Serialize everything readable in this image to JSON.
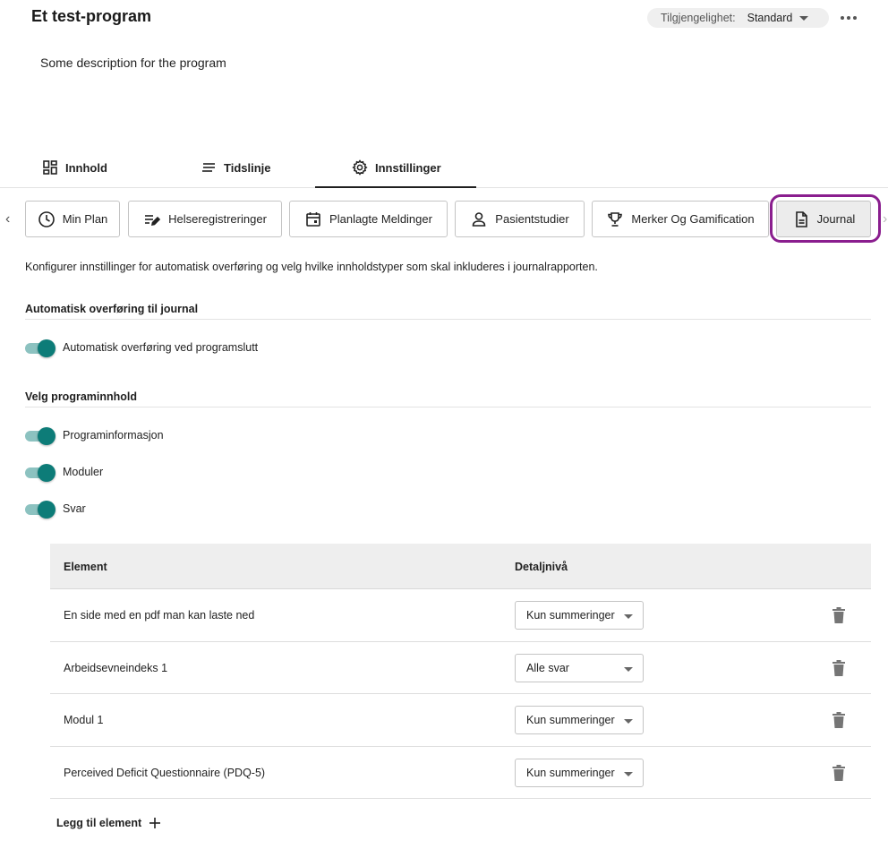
{
  "header": {
    "title": "Et test-program",
    "availability_label": "Tilgjengelighet:",
    "availability_value": "Standard",
    "more_icon": "more-horizontal-icon"
  },
  "description": "Some description for the program",
  "main_tabs": [
    {
      "label": "Innhold",
      "icon": "grid-icon"
    },
    {
      "label": "Tidslinje",
      "icon": "lines-icon"
    },
    {
      "label": "Innstillinger",
      "icon": "gear-icon",
      "active": true
    }
  ],
  "settings_tabs": [
    {
      "label": "Min Plan",
      "icon": "clock-icon"
    },
    {
      "label": "Helseregistreringer",
      "icon": "edit-list-icon"
    },
    {
      "label": "Planlagte Meldinger",
      "icon": "calendar-icon"
    },
    {
      "label": "Pasientstudier",
      "icon": "person-icon"
    },
    {
      "label": "Merker Og Gamification",
      "icon": "trophy-icon"
    },
    {
      "label": "Journal",
      "icon": "document-icon",
      "selected": true
    }
  ],
  "intro": "Konfigurer innstillinger for automatisk overføring og velg hvilke innholdstyper som skal inkluderes i journalrapporten.",
  "auto_transfer": {
    "heading": "Automatisk overføring til journal",
    "toggle_label": "Automatisk overføring ved programslutt",
    "enabled": true
  },
  "content_selection": {
    "heading": "Velg programinnhold",
    "toggles": [
      {
        "label": "Programinformasjon",
        "enabled": true
      },
      {
        "label": "Moduler",
        "enabled": true
      },
      {
        "label": "Svar",
        "enabled": true
      }
    ]
  },
  "table": {
    "headers": {
      "element": "Element",
      "detail": "Detaljnivå"
    },
    "rows": [
      {
        "element": "En side med en pdf man kan laste ned",
        "detail": "Kun summeringer"
      },
      {
        "element": "Arbeidsevneindeks 1",
        "detail": "Alle svar"
      },
      {
        "element": "Modul 1",
        "detail": "Kun summeringer"
      },
      {
        "element": "Perceived Deficit Questionnaire (PDQ-5)",
        "detail": "Kun summeringer"
      }
    ]
  },
  "add_element_label": "Legg til element",
  "colors": {
    "toggle_on": "#0d7c78",
    "toggle_track": "#8cc2c0",
    "highlight": "#8a1e8e"
  }
}
